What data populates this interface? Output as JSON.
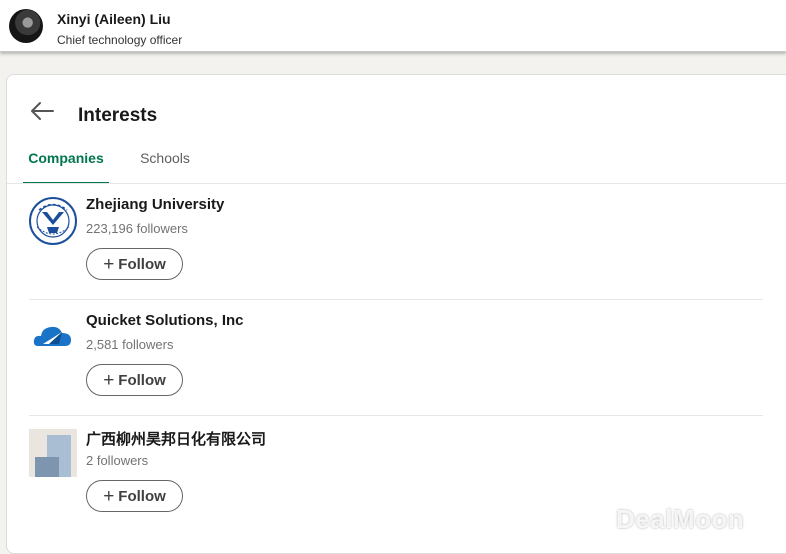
{
  "profile": {
    "name": "Xinyi (Aileen) Liu",
    "title": "Chief technology officer"
  },
  "card": {
    "title": "Interests",
    "back_icon": "arrow-left-icon"
  },
  "tabs": [
    {
      "label": "Companies",
      "active": true
    },
    {
      "label": "Schools",
      "active": false
    }
  ],
  "items": [
    {
      "name": "Zhejiang University",
      "followers": "223,196 followers",
      "follow_label": "Follow",
      "logo": "zhejiang-university-seal"
    },
    {
      "name": "Quicket Solutions, Inc",
      "followers": "2,581 followers",
      "follow_label": "Follow",
      "logo": "quicket-cloud-logo"
    },
    {
      "name": "广西柳州昊邦日化有限公司",
      "followers": "2 followers",
      "follow_label": "Follow",
      "logo": "placeholder-company-logo"
    }
  ],
  "watermark": "DealMoon",
  "colors": {
    "accent": "#01754f",
    "brand_blue": "#1a73c7",
    "seal_blue": "#1b4f9c"
  }
}
